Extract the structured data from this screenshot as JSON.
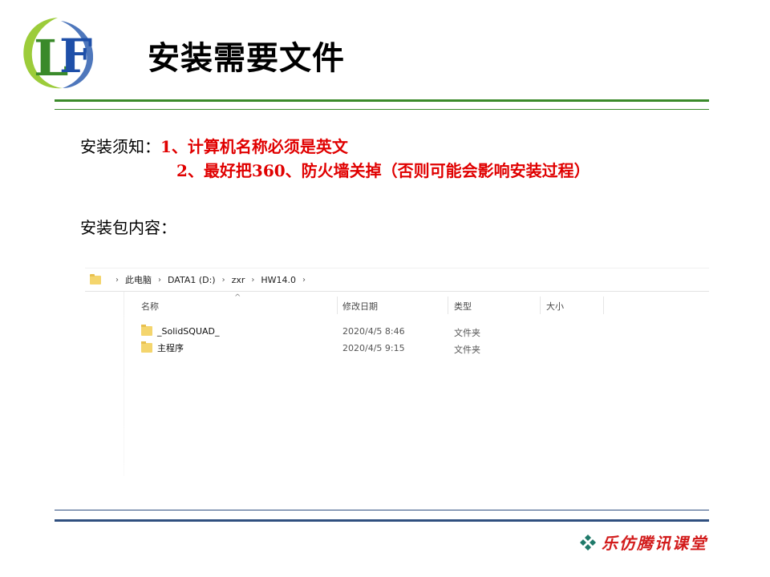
{
  "slide": {
    "title": "安装需要文件",
    "notes_label": "安装须知：",
    "note1": "1、计算机名称必须是英文",
    "note2": "2、最好把360、防火墙关掉（否则可能会影响安装过程）",
    "package_label": "安装包内容：",
    "brand": "乐仿腾讯课堂"
  },
  "explorer": {
    "breadcrumb": [
      "此电脑",
      "DATA1 (D:)",
      "zxr",
      "HW14.0"
    ],
    "columns": [
      "名称",
      "修改日期",
      "类型",
      "大小"
    ],
    "files": [
      {
        "name": "_SolidSQUAD_",
        "modified": "2020/4/5 8:46",
        "type": "文件夹",
        "size": ""
      },
      {
        "name": "主程序",
        "modified": "2020/4/5 9:15",
        "type": "文件夹",
        "size": ""
      }
    ]
  },
  "colors": {
    "accent_green": "#3a8a2a",
    "accent_blue": "#2f4f7f",
    "note_red": "#e00000",
    "brand_red": "#d21b1b"
  },
  "icons": [
    "lf-logo-icon",
    "folder-icon",
    "chevron-right-icon",
    "sort-up-icon",
    "diamond-cluster-icon"
  ]
}
